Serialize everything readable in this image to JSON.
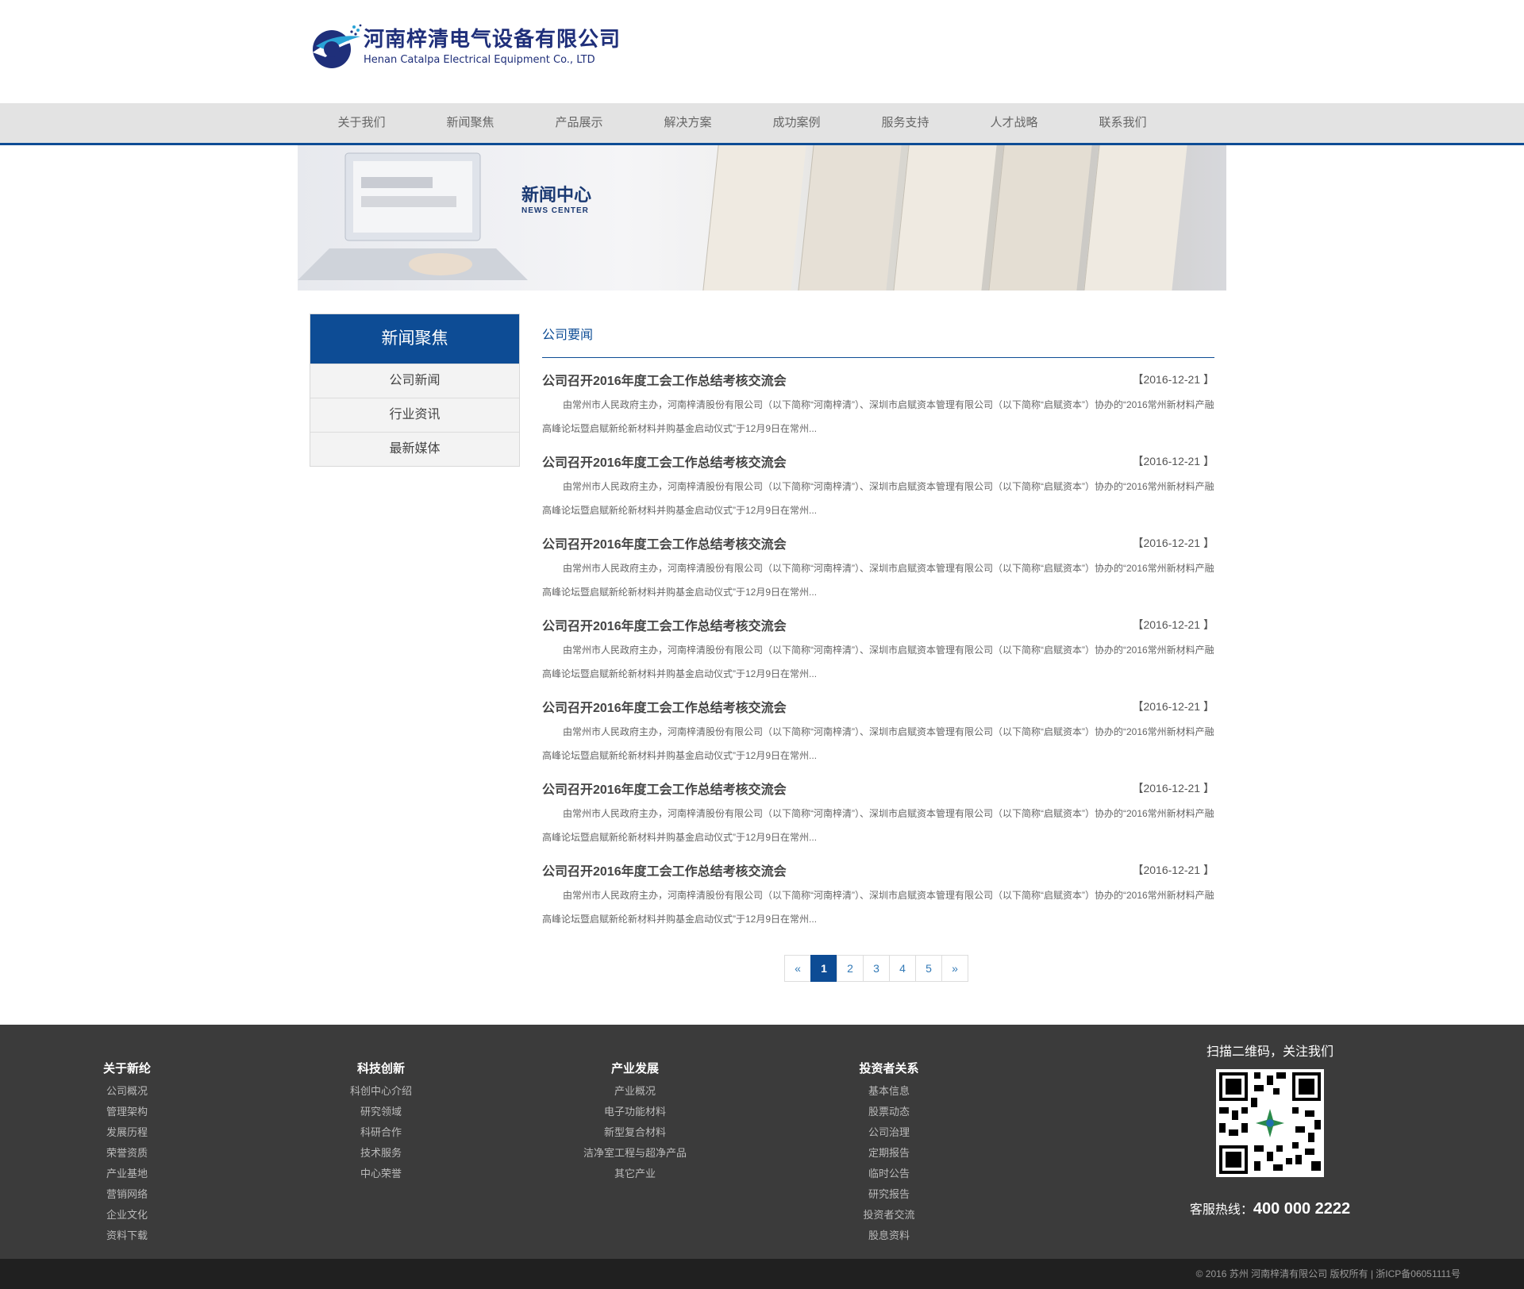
{
  "header": {
    "company_cn": "河南梓清电气设备有限公司",
    "company_en": "Henan Catalpa Electrical Equipment Co., LTD"
  },
  "nav": {
    "items": [
      "关于我们",
      "新闻聚焦",
      "产品展示",
      "解决方案",
      "成功案例",
      "服务支持",
      "人才战略",
      "联系我们"
    ]
  },
  "banner": {
    "title_cn": "新闻中心",
    "title_en": "NEWS CENTER"
  },
  "sidebar": {
    "title": "新闻聚焦",
    "items": [
      "公司新闻",
      "行业资讯",
      "最新媒体"
    ]
  },
  "main": {
    "section_title": "公司要闻",
    "news": [
      {
        "title": "公司召开2016年度工会工作总结考核交流会",
        "date": "【2016-12-21 】",
        "desc": "由常州市人民政府主办，河南梓清股份有限公司（以下简称“河南梓清”）、深圳市启赋资本管理有限公司（以下简称“启赋资本”）协办的“2016常州新材料产融高峰论坛暨启赋新纶新材料并购基金启动仪式”于12月9日在常州..."
      },
      {
        "title": "公司召开2016年度工会工作总结考核交流会",
        "date": "【2016-12-21 】",
        "desc": "由常州市人民政府主办，河南梓清股份有限公司（以下简称“河南梓清”）、深圳市启赋资本管理有限公司（以下简称“启赋资本”）协办的“2016常州新材料产融高峰论坛暨启赋新纶新材料并购基金启动仪式”于12月9日在常州..."
      },
      {
        "title": "公司召开2016年度工会工作总结考核交流会",
        "date": "【2016-12-21 】",
        "desc": "由常州市人民政府主办，河南梓清股份有限公司（以下简称“河南梓清”）、深圳市启赋资本管理有限公司（以下简称“启赋资本”）协办的“2016常州新材料产融高峰论坛暨启赋新纶新材料并购基金启动仪式”于12月9日在常州..."
      },
      {
        "title": "公司召开2016年度工会工作总结考核交流会",
        "date": "【2016-12-21 】",
        "desc": "由常州市人民政府主办，河南梓清股份有限公司（以下简称“河南梓清”）、深圳市启赋资本管理有限公司（以下简称“启赋资本”）协办的“2016常州新材料产融高峰论坛暨启赋新纶新材料并购基金启动仪式”于12月9日在常州..."
      },
      {
        "title": "公司召开2016年度工会工作总结考核交流会",
        "date": "【2016-12-21 】",
        "desc": "由常州市人民政府主办，河南梓清股份有限公司（以下简称“河南梓清”）、深圳市启赋资本管理有限公司（以下简称“启赋资本”）协办的“2016常州新材料产融高峰论坛暨启赋新纶新材料并购基金启动仪式”于12月9日在常州..."
      },
      {
        "title": "公司召开2016年度工会工作总结考核交流会",
        "date": "【2016-12-21 】",
        "desc": "由常州市人民政府主办，河南梓清股份有限公司（以下简称“河南梓清”）、深圳市启赋资本管理有限公司（以下简称“启赋资本”）协办的“2016常州新材料产融高峰论坛暨启赋新纶新材料并购基金启动仪式”于12月9日在常州..."
      },
      {
        "title": "公司召开2016年度工会工作总结考核交流会",
        "date": "【2016-12-21 】",
        "desc": "由常州市人民政府主办，河南梓清股份有限公司（以下简称“河南梓清”）、深圳市启赋资本管理有限公司（以下简称“启赋资本”）协办的“2016常州新材料产融高峰论坛暨启赋新纶新材料并购基金启动仪式”于12月9日在常州..."
      }
    ]
  },
  "pagination": {
    "prev": "«",
    "pages": [
      "1",
      "2",
      "3",
      "4",
      "5"
    ],
    "current": "1",
    "next": "»"
  },
  "footer": {
    "columns": [
      {
        "title": "关于新纶",
        "links": [
          "公司概况",
          "管理架构",
          "发展历程",
          "荣誉资质",
          "产业基地",
          "营销网络",
          "企业文化",
          "资料下载"
        ]
      },
      {
        "title": "科技创新",
        "links": [
          "科创中心介绍",
          "研究领域",
          "科研合作",
          "技术服务",
          "中心荣誉"
        ]
      },
      {
        "title": "产业发展",
        "links": [
          "产业概况",
          "电子功能材料",
          "新型复合材料",
          "洁净室工程与超净产品",
          "其它产业"
        ]
      },
      {
        "title": "投资者关系",
        "links": [
          "基本信息",
          "股票动态",
          "公司治理",
          "定期报告",
          "临时公告",
          "研究报告",
          "投资者交流",
          "股息资料"
        ]
      }
    ],
    "qr_caption": "扫描二维码，关注我们",
    "hotline_label": "客服热线：",
    "hotline_number": "400 000 2222"
  },
  "copyright": "© 2016 苏州 河南梓清有限公司 版权所有 | 浙ICP备06051111号",
  "colors": {
    "brand": "#0d4c95",
    "footer_bg": "#3b3b3b",
    "copyright_bg": "#202020"
  }
}
